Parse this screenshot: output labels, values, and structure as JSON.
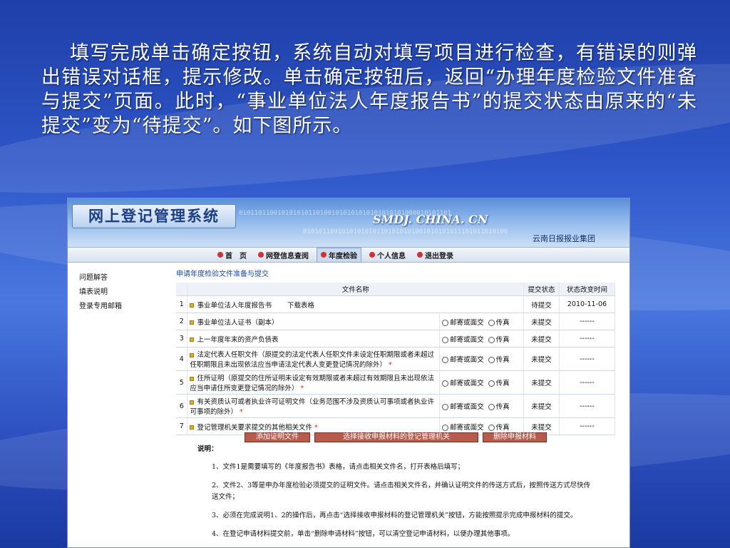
{
  "slide": {
    "text": "填写完成单击确定按钮，系统自动对填写项目进行检查，有错误的则弹出错误对话框，提示修改。单击确定按钮后，返回“办理年度检验文件准备与提交”页面。此时，“事业单位法人年度报告书”的提交状态由原来的“未提交”变为“待提交”。如下图所示。"
  },
  "header": {
    "logo": "网上登记管理系统",
    "domain": "SMDJ. CHINA. CN",
    "org": "云南日报报业集团",
    "binary1": "0101101100101010101101001010101010101010101000010101101",
    "binary2": "01010110010101010101101010101001010101011101011010100"
  },
  "nav": [
    {
      "label": "首　页"
    },
    {
      "label": "网登信息查阅"
    },
    {
      "label": "年度检验"
    },
    {
      "label": "个人信息"
    },
    {
      "label": "退出登录"
    }
  ],
  "sidebar": [
    "问题解答",
    "填表说明",
    "登录专用邮箱"
  ],
  "breadcrumb": "申请年度检验文件准备与提交",
  "table": {
    "headers": [
      "文件名称",
      "提交状态",
      "状态改变时间"
    ],
    "option_mail": "邮寄或面交",
    "option_fax": "传真",
    "download": "下载表格",
    "rows": [
      {
        "idx": "1",
        "name": "事业单位法人年度报告书",
        "status": "待提交",
        "time": "2010-11-06"
      },
      {
        "idx": "2",
        "name": "事业单位法人证书（副本）",
        "status": "未提交",
        "time": "------"
      },
      {
        "idx": "3",
        "name": "上一年度年末的资产负债表",
        "status": "未提交",
        "time": "------"
      },
      {
        "idx": "4",
        "name": "法定代表人任职文件（原提交的法定代表人任职文件未设定任职期限或者未超过任职期限且未出现依法应当申请法定代表人变更登记情况的除外）",
        "status": "未提交",
        "time": "------"
      },
      {
        "idx": "5",
        "name": "住所证明（原提交的住所证明未设定有效期限或者未超过有效期限且未出现依法应当申请住所变更登记情况的除外）",
        "status": "未提交",
        "time": "------"
      },
      {
        "idx": "6",
        "name": "有关资质认可或者执业许可证明文件（业务范围不涉及资质认可事项或者执业许可事项的除外）",
        "status": "未提交",
        "time": "------"
      },
      {
        "idx": "7",
        "name": "登记管理机关要求提交的其他相关文件",
        "status": "未提交",
        "time": "------"
      }
    ]
  },
  "actions": [
    "添加证明文件",
    "选择接收申报材料的登记管理机关",
    "删除申报材料"
  ],
  "notes": {
    "title": "说明：",
    "items": [
      "1、文件1是需要填写的《年度报告书》表格，请点击相关文件名，打开表格后填写；",
      "2、文件2、3等是申办年度检验必须提交的证明文件。请点击相关文件名，并确认证明文件的传送方式后，按照传送方式尽快传送文件；",
      "3、必须在完成说明1、2的操作后，再点击“选择接收申报材料的登记管理机关”按钮，方能按照提示完成申报材料的提交。",
      "4、在登记申请材料提交前，单击“删除申请材料”按钮，可以清空登记申请材料，以便办理其他事项。"
    ]
  },
  "colors": {
    "accent": "#1a4aa8",
    "button": "#b85a4c",
    "required": "#e02020"
  }
}
